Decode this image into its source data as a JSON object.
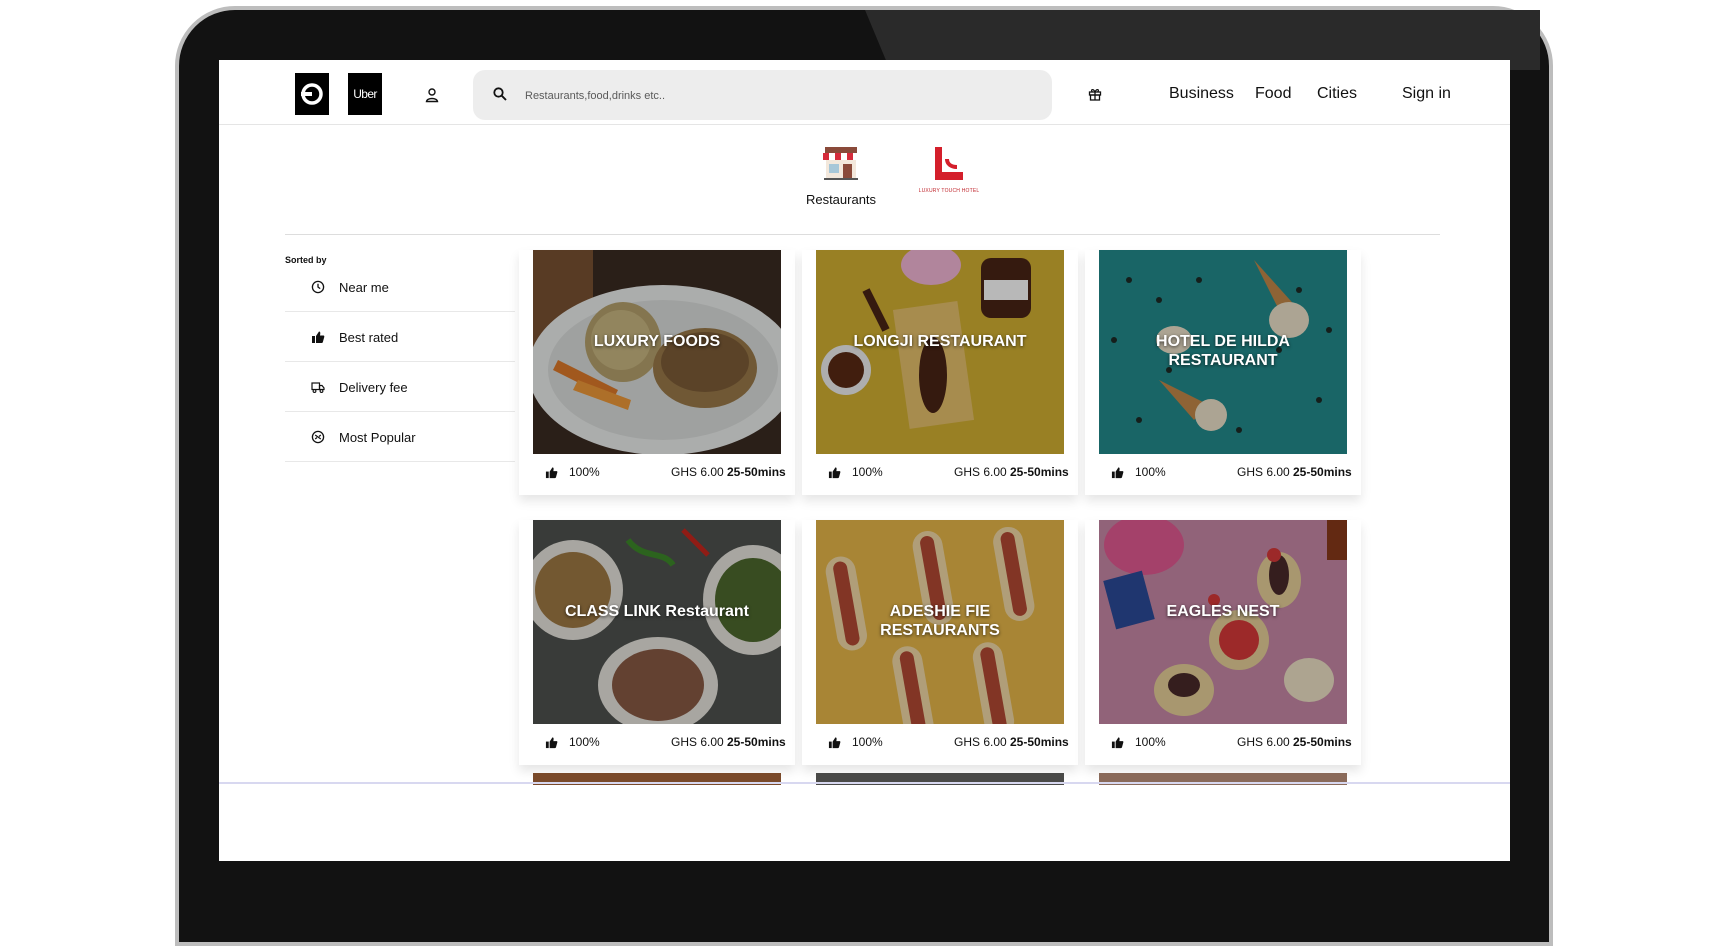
{
  "header": {
    "logo_alt": "Uber",
    "uber_wordmark": "Uber",
    "search_placeholder": "Restaurants,food,drinks etc..",
    "nav": [
      "Business",
      "Food",
      "Cities",
      "Sign in"
    ]
  },
  "categories": [
    {
      "label": "Restaurants",
      "icon": "storefront-icon"
    },
    {
      "label": "LUXURY TOUCH HOTEL",
      "icon": "luxury-touch-logo"
    }
  ],
  "sidebar": {
    "heading": "Sorted by",
    "items": [
      {
        "label": "Near me",
        "icon": "clock-icon"
      },
      {
        "label": "Best rated",
        "icon": "thumbs-up-icon"
      },
      {
        "label": "Delivery fee",
        "icon": "delivery-truck-icon"
      },
      {
        "label": "Most Popular",
        "icon": "badge-icon"
      }
    ]
  },
  "restaurants": [
    {
      "name": "LUXURY FOODS",
      "rating": "100%",
      "fee": "GHS 6.00",
      "time": "25-50mins",
      "image": "grilled-chicken-rice"
    },
    {
      "name": "LONGJI RESTAURANT",
      "rating": "100%",
      "fee": "GHS 6.00",
      "time": "25-50mins",
      "image": "nutella-dessert"
    },
    {
      "name": "HOTEL DE HILDA RESTAURANT",
      "rating": "100%",
      "fee": "GHS 6.00",
      "time": "25-50mins",
      "image": "ice-cream-cones"
    },
    {
      "name": "CLASS LINK Restaurant",
      "rating": "100%",
      "fee": "GHS 6.00",
      "time": "25-50mins",
      "image": "salad-bowls"
    },
    {
      "name": "ADESHIE FIE RESTAURANTS",
      "rating": "100%",
      "fee": "GHS 6.00",
      "time": "25-50mins",
      "image": "hot-dogs"
    },
    {
      "name": "EAGLES NEST",
      "rating": "100%",
      "fee": "GHS 6.00",
      "time": "25-50mins",
      "image": "desserts-pink"
    }
  ],
  "colors": {
    "brand_black": "#000000",
    "search_bg": "#ededed",
    "luxury_red": "#c0262d"
  }
}
